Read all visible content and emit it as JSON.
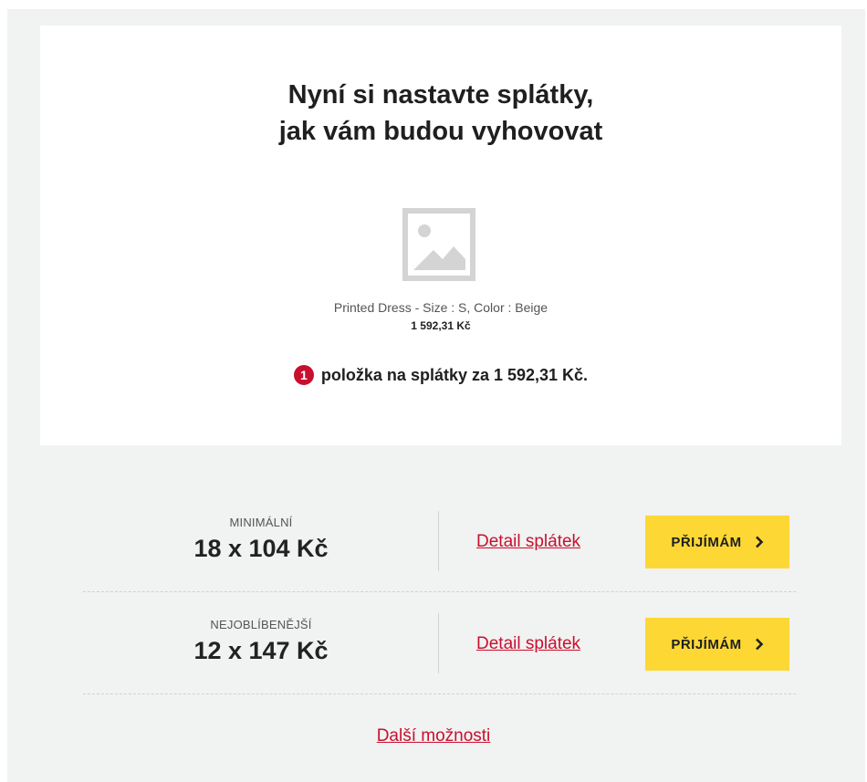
{
  "title_line1": "Nyní si nastavte splátky,",
  "title_line2": "jak vám budou vyhovovat",
  "product": {
    "name": "Printed Dress - Size : S, Color : Beige",
    "price": "1 592,31 Kč",
    "image_icon": "image-placeholder-icon"
  },
  "summary": {
    "count": "1",
    "text": "položka na splátky za 1 592,31 Kč."
  },
  "options": [
    {
      "label": "MINIMÁLNÍ",
      "amount": "18 x 104 Kč",
      "detail_link": "Detail splátek",
      "accept_label": "PŘIJÍMÁM"
    },
    {
      "label": "NEJOBLÍBENĚJŠÍ",
      "amount": "12 x 147 Kč",
      "detail_link": "Detail splátek",
      "accept_label": "PŘIJÍMÁM"
    }
  ],
  "more_options": "Další možnosti",
  "colors": {
    "accent_red": "#c8102e",
    "button_yellow": "#fdd835",
    "background_gray": "#f1f2f2"
  }
}
